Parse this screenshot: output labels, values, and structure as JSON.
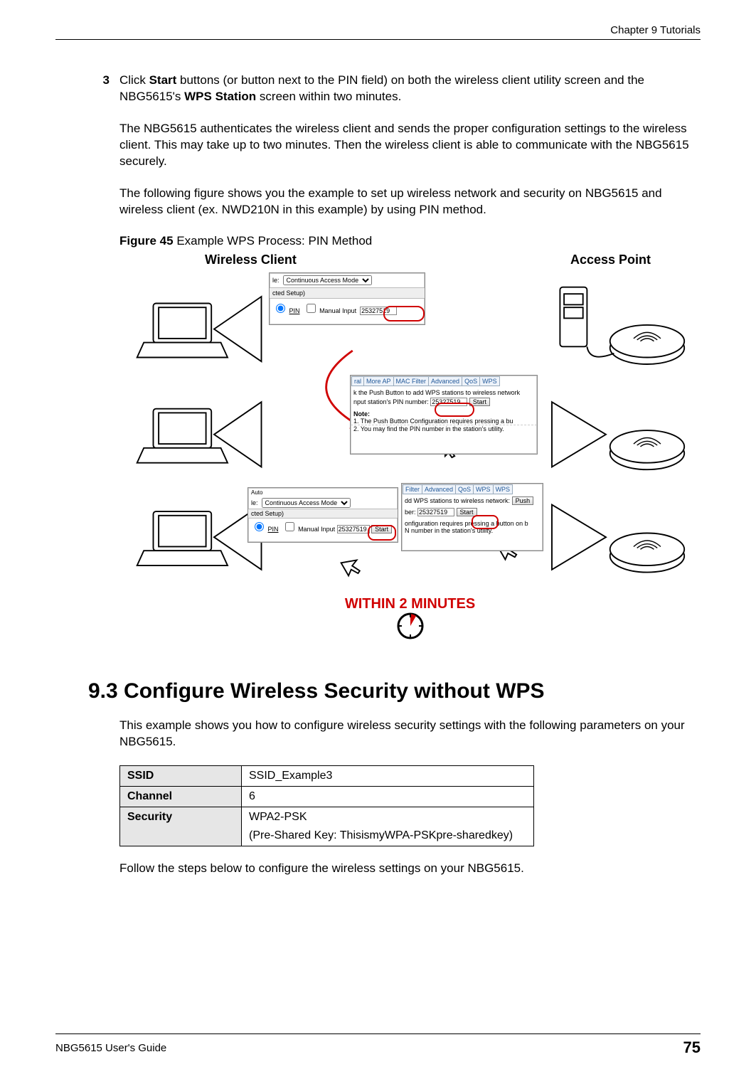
{
  "header": {
    "chapter": "Chapter 9 Tutorials"
  },
  "step3": {
    "num": "3",
    "pre": "Click ",
    "start": "Start",
    "mid": " buttons (or button next to the PIN field) on both the wireless client utility screen and the NBG5615's ",
    "wps": "WPS Station",
    "post": " screen within two minutes."
  },
  "para1": "The NBG5615 authenticates the wireless client and sends the proper configuration settings to the wireless client. This may take up to two minutes. Then the wireless client is able to communicate with the NBG5615 securely.",
  "para2": "The following figure shows you the example to set up wireless network and security on NBG5615 and wireless client (ex. NWD210N in this example) by using PIN method.",
  "fig": {
    "label": "Figure 45",
    "title": "   Example WPS Process: PIN Method",
    "wireless": "Wireless Client",
    "ap": "Access Point",
    "within": "WITHIN 2 MINUTES",
    "snip": {
      "mode": "Continuous Access Mode",
      "cted": "cted Setup)",
      "pin": "PIN",
      "manual": "Manual Input",
      "pin_value": "25327519",
      "start": "Start",
      "auto": "Auto",
      "tabs": [
        "ral",
        "More AP",
        "MAC Filter",
        "Advanced",
        "QoS",
        "WPS"
      ],
      "tabs2": [
        "Filter",
        "Advanced",
        "QoS",
        "WPS",
        "WPS"
      ],
      "line1": "k the Push Button to add WPS stations to wireless network",
      "line2": "nput station's PIN number:",
      "note": "Note:",
      "n1": "1. The Push Button Configuration requires pressing a bu",
      "n2": "2. You may find the PIN number in the station's utility.",
      "dd": "dd WPS stations to wireless network:",
      "push": "Push",
      "ber": "ber:",
      "conf": "onfiguration requires pressing a button on b",
      "util": "N number in the station's utility."
    }
  },
  "section": {
    "num": "9.3",
    "title": "  Configure Wireless Security without WPS"
  },
  "para3": "This example shows you how to configure wireless security settings with the following parameters on your NBG5615.",
  "table": {
    "r1": {
      "k": "SSID",
      "v": "SSID_Example3"
    },
    "r2": {
      "k": "Channel",
      "v": "6"
    },
    "r3": {
      "k": "Security",
      "v1": "WPA2-PSK",
      "v2": "(Pre-Shared Key: ThisismyWPA-PSKpre-sharedkey)"
    }
  },
  "para4": "Follow the steps below to configure the wireless settings on your NBG5615.",
  "footer": {
    "guide": "NBG5615 User's Guide",
    "page": "75"
  }
}
